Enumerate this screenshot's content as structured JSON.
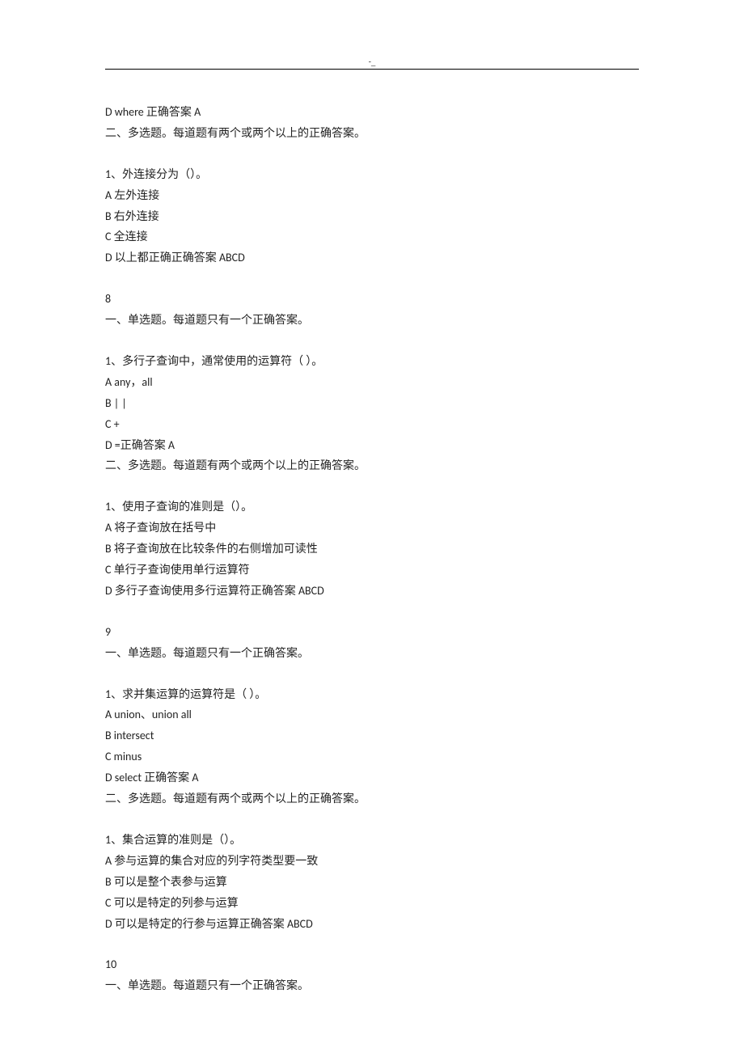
{
  "header": {
    "mark": "-_"
  },
  "lines": {
    "l01": "D where 正确答案 A",
    "l02": "二、多选题。每道题有两个或两个以上的正确答案。",
    "l03": "1、外连接分为（）。",
    "l04": "A 左外连接",
    "l05": "B 右外连接",
    "l06": "C 全连接",
    "l07": "D 以上都正确正确答案 ABCD",
    "l08": "8",
    "l09": "一、单选题。每道题只有一个正确答案。",
    "l10": "1、多行子查询中，通常使用的运算符（ ）。",
    "l11": "A any，all",
    "l12": "B | |",
    "l13": "C +",
    "l14": "D =正确答案 A",
    "l15": "二、多选题。每道题有两个或两个以上的正确答案。",
    "l16": "1、使用子查询的准则是（）。",
    "l17": "A 将子查询放在括号中",
    "l18": "B 将子查询放在比较条件的右侧增加可读性",
    "l19": "C 单行子查询使用单行运算符",
    "l20": "D 多行子查询使用多行运算符正确答案 ABCD",
    "l21": "9",
    "l22": "一、单选题。每道题只有一个正确答案。",
    "l23": "1、求并集运算的运算符是（ ）。",
    "l24": "A union、union all",
    "l25": "B intersect",
    "l26": "C minus",
    "l27": "D select 正确答案 A",
    "l28": "二、多选题。每道题有两个或两个以上的正确答案。",
    "l29": "1、集合运算的准则是（）。",
    "l30": "A 参与运算的集合对应的列字符类型要一致",
    "l31": "B 可以是整个表参与运算",
    "l32": "C 可以是特定的列参与运算",
    "l33": "D 可以是特定的行参与运算正确答案 ABCD",
    "l34": "10",
    "l35": "一、单选题。每道题只有一个正确答案。"
  }
}
